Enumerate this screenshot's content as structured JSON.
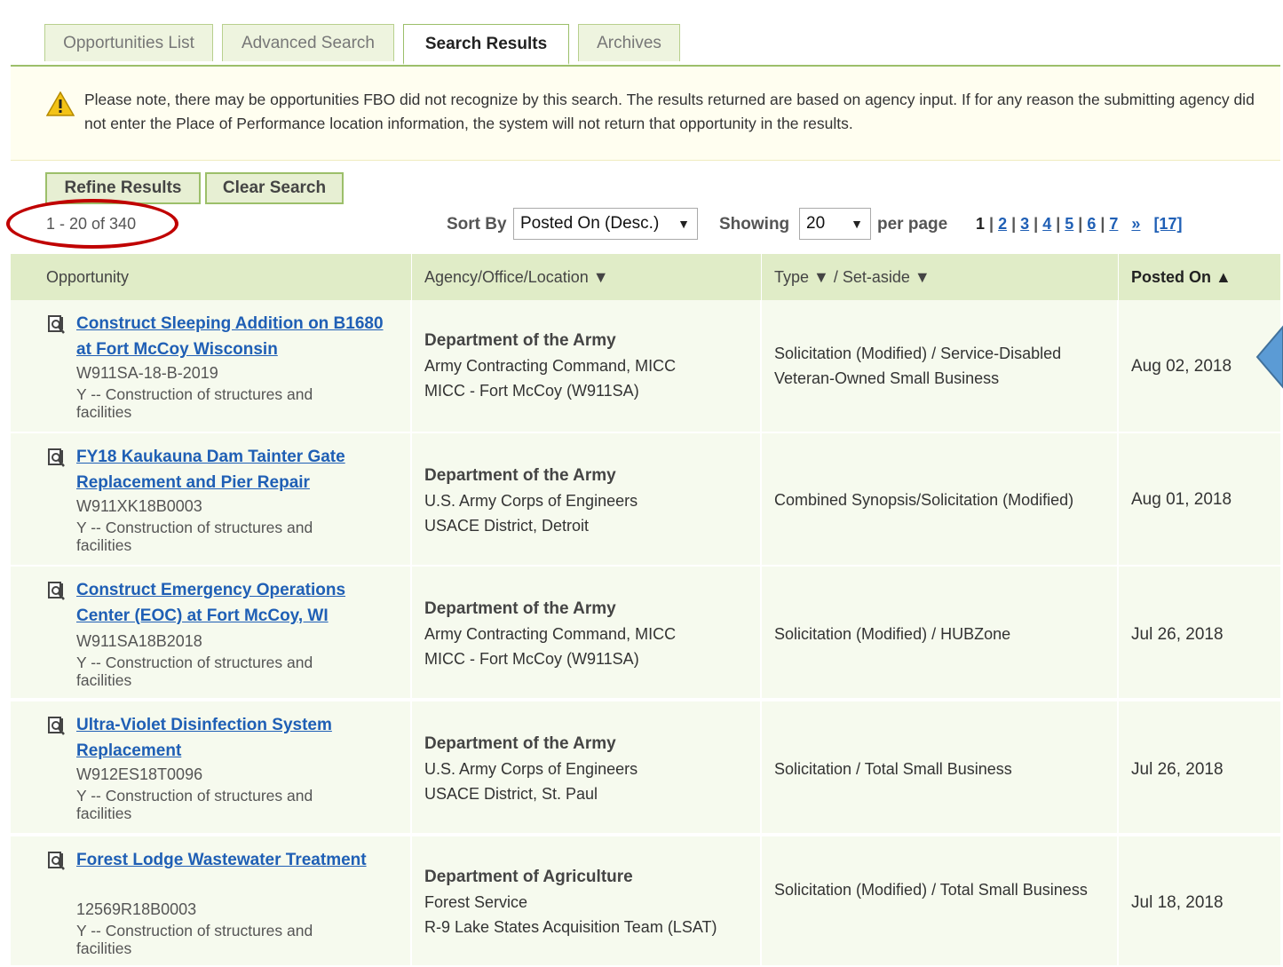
{
  "tabs": [
    {
      "label": "Opportunities List"
    },
    {
      "label": "Advanced Search"
    },
    {
      "label": "Search Results"
    },
    {
      "label": "Archives"
    }
  ],
  "notice": {
    "text": "Please note, there may be opportunities FBO did not recognize by this search. The results returned are based on agency input. If for any reason the submitting agency did not enter the Place of Performance location information, the system will not return that opportunity in the results."
  },
  "buttons": {
    "refine": "Refine Results",
    "clear": "Clear Search"
  },
  "results": {
    "count": "1 - 20 of 340"
  },
  "sort": {
    "label": "Sort By",
    "selected": "Posted On (Desc.)"
  },
  "showing": {
    "label": "Showing",
    "selected": "20",
    "suffix": "per page"
  },
  "pagination": {
    "current": "1",
    "pages": [
      "2",
      "3",
      "4",
      "5",
      "6",
      "7"
    ],
    "next": "»",
    "last": "[17]"
  },
  "table": {
    "headers": {
      "opportunity": "Opportunity",
      "agency": "Agency/Office/Location ▼",
      "type": "Type ▼ / Set-aside ▼",
      "posted": "Posted On ▲"
    },
    "rows": [
      {
        "title": "Construct Sleeping Addition on B1680 at Fort McCoy Wisconsin",
        "solicitation": "W911SA-18-B-2019",
        "classification": "Y -- Construction of structures and facilities",
        "department": "Department of the Army",
        "office": "Army Contracting Command, MICC",
        "location": "MICC - Fort McCoy (W911SA)",
        "type": "Solicitation (Modified) / Service-Disabled Veteran-Owned Small Business",
        "posted": "Aug 02, 2018"
      },
      {
        "title": "FY18 Kaukauna Dam Tainter Gate Replacement and Pier Repair",
        "solicitation": "W911XK18B0003",
        "classification": "Y -- Construction of structures and facilities",
        "department": "Department of the Army",
        "office": "U.S. Army Corps of Engineers",
        "location": "USACE District, Detroit",
        "type": "Combined Synopsis/Solicitation (Modified)",
        "posted": "Aug 01, 2018"
      },
      {
        "title": "Construct Emergency Operations Center (EOC) at Fort McCoy, WI",
        "solicitation": "W911SA18B2018",
        "classification": "Y -- Construction of structures and facilities",
        "department": "Department of the Army",
        "office": "Army Contracting Command, MICC",
        "location": "MICC - Fort McCoy (W911SA)",
        "type": "Solicitation (Modified) / HUBZone",
        "posted": "Jul 26, 2018"
      },
      {
        "title": "Ultra-Violet Disinfection System Replacement",
        "solicitation": "W912ES18T0096",
        "classification": "Y -- Construction of structures and facilities",
        "department": "Department of the Army",
        "office": "U.S. Army Corps of Engineers",
        "location": "USACE District, St. Paul",
        "type": "Solicitation / Total Small Business",
        "posted": "Jul 26, 2018"
      },
      {
        "title": "Forest Lodge Wastewater Treatment",
        "solicitation": "12569R18B0003",
        "classification": "Y -- Construction of structures and facilities",
        "department": "Department of Agriculture",
        "office": "Forest Service",
        "location": "R-9 Lake States Acquisition Team (LSAT)",
        "type": "Solicitation (Modified) / Total Small Business",
        "posted": "Jul 18, 2018"
      }
    ]
  },
  "colors": {
    "accent_green": "#9cbf6a",
    "link_blue": "#1f5fb5",
    "highlight_red": "#c00000",
    "arrow_blue": "#5b9bd5"
  }
}
